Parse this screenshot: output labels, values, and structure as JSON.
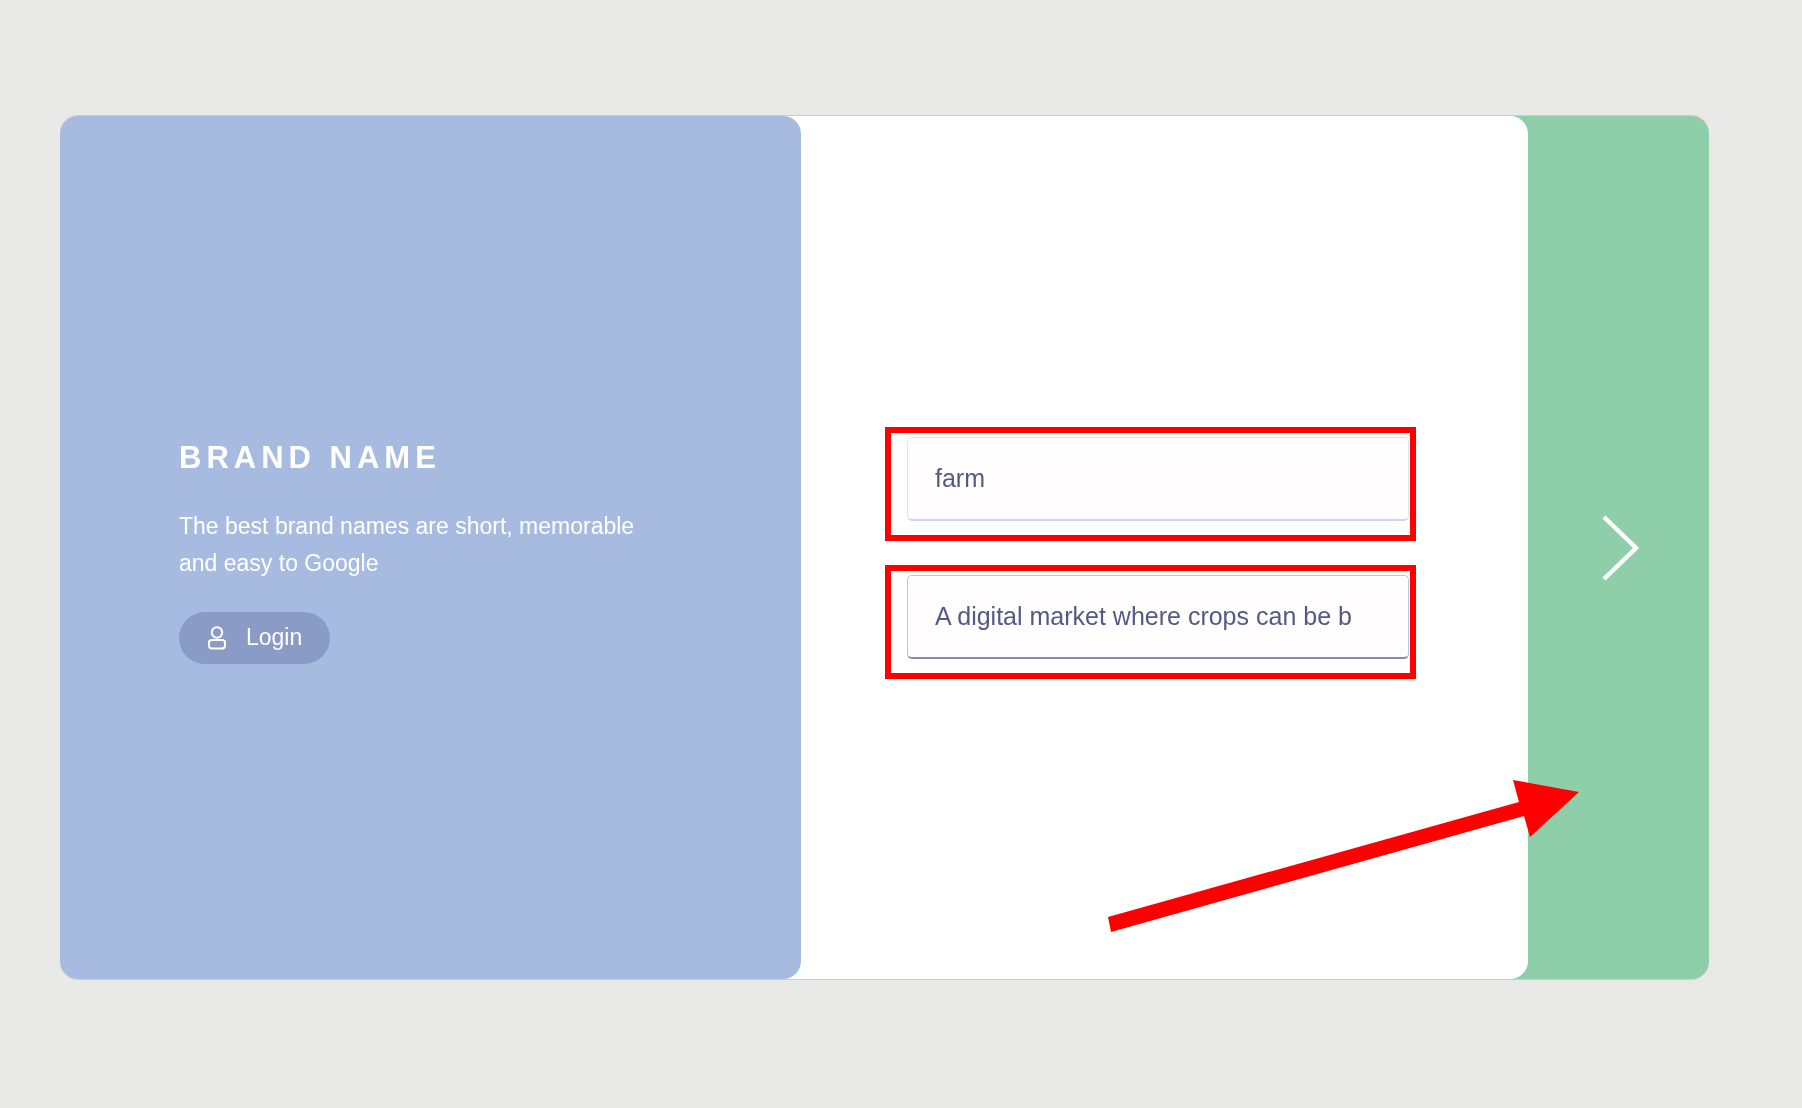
{
  "brand": {
    "title": "BRAND NAME",
    "description": "The best brand names are short, memorable and easy to Google",
    "login_button": "Login"
  },
  "form": {
    "fields": [
      {
        "value": "farm",
        "focused": false,
        "highlighted": true
      },
      {
        "value": "A digital market where crops can be b",
        "focused": true,
        "highlighted": true
      }
    ]
  }
}
